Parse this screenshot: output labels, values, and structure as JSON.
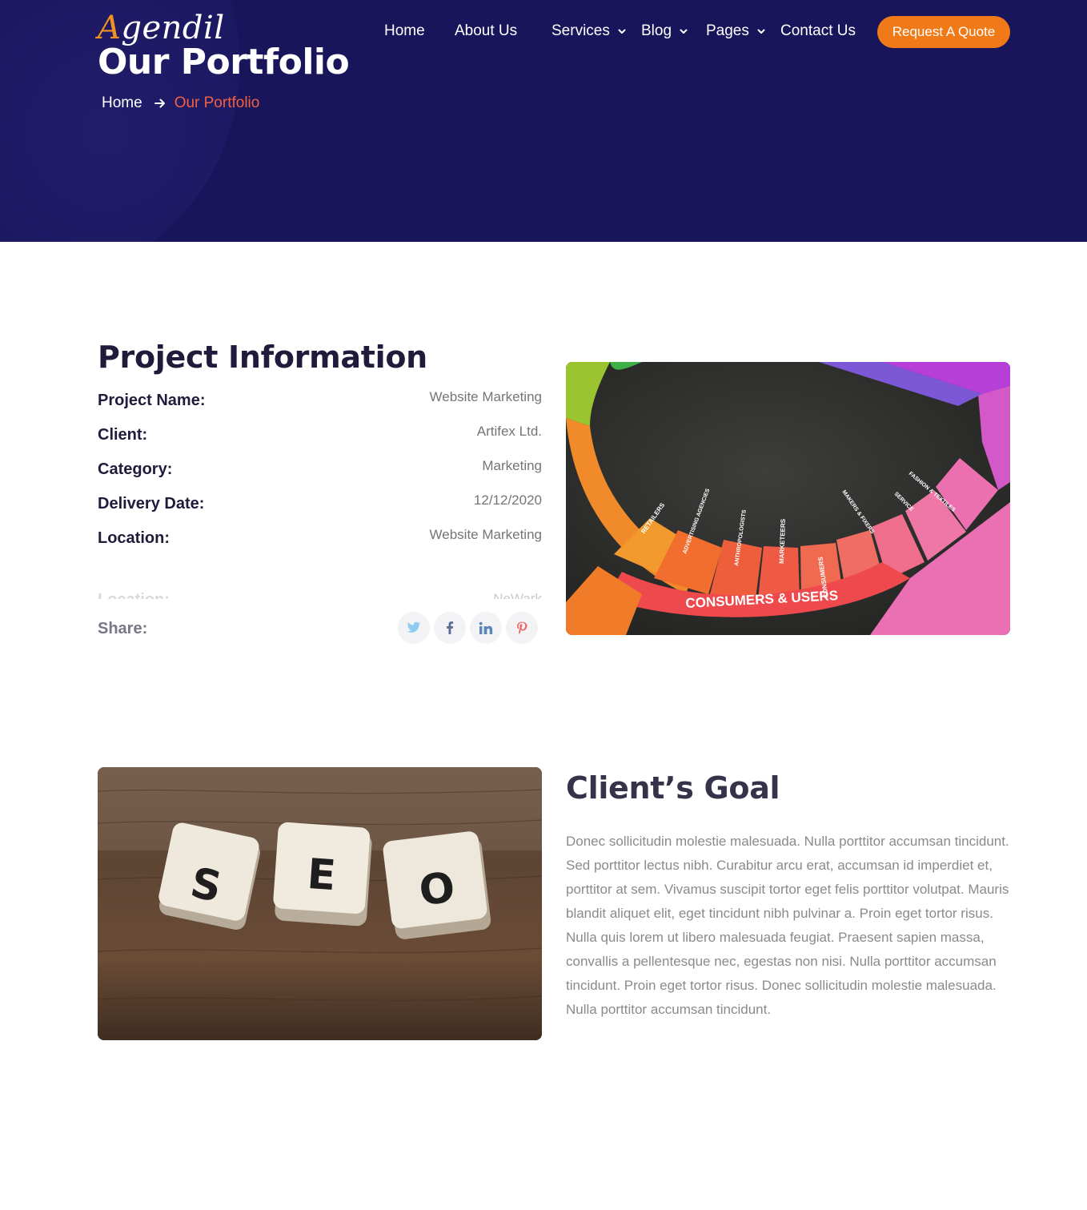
{
  "brand": {
    "logo_first": "A",
    "logo_rest": "gendil"
  },
  "hero": {
    "title": "Our Portfolio",
    "breadcrumb": {
      "home": "Home",
      "current": "Our Portfolio"
    }
  },
  "nav": {
    "items": [
      {
        "label": "Home",
        "dropdown": false
      },
      {
        "label": "About Us",
        "dropdown": false
      },
      {
        "label": "Services",
        "dropdown": true
      },
      {
        "label": "Blog",
        "dropdown": true
      },
      {
        "label": "Pages",
        "dropdown": true
      },
      {
        "label": "Contact Us",
        "dropdown": false
      }
    ],
    "cta": "Request A Quote"
  },
  "project": {
    "title": "Project Information",
    "rows": [
      {
        "label": "Project Name:",
        "value": "Website Marketing"
      },
      {
        "label": "Client:",
        "value": "Artifex Ltd."
      },
      {
        "label": "Category:",
        "value": "Marketing"
      },
      {
        "label": "Delivery Date:",
        "value": "12/12/2020"
      },
      {
        "label": "Location:",
        "value": "Website Marketing"
      }
    ],
    "faded_row": {
      "label": "Location:",
      "value": "NeWark"
    },
    "share_label": "Share:",
    "social": [
      "twitter-icon",
      "facebook-icon",
      "linkedin-icon",
      "pinterest-icon"
    ]
  },
  "images": {
    "wheel_caption": "CONSUMERS & USERS",
    "wheel_segments": [
      "RETAILERS",
      "ADVERTISING AGENCIES",
      "ANTHROPOLOGISTS",
      "MARKETEERS",
      "CONSUMERS",
      "MAKERS & FIXERS",
      "SERVICE",
      "FASHION & TEXTILES"
    ],
    "seo_tiles": [
      "S",
      "E",
      "O"
    ]
  },
  "goal": {
    "title": "Client’s Goal",
    "text": "Donec sollicitudin molestie malesuada. Nulla porttitor accumsan tincidunt. Sed porttitor lectus nibh. Curabitur arcu erat, accumsan id imperdiet et, porttitor at sem. Vivamus suscipit tortor eget felis porttitor volutpat. Mauris blandit aliquet elit, eget tincidunt nibh pulvinar a. Proin eget tortor risus. Nulla quis lorem ut libero malesuada feugiat. Praesent sapien massa, convallis a pellentesque nec, egestas non nisi. Nulla porttitor accumsan tincidunt. Proin eget tortor risus. Donec sollicitudin molestie malesuada. Nulla porttitor accumsan tincidunt."
  },
  "colors": {
    "hero_bg": "#19155a",
    "accent_orange": "#f17a18",
    "breadcrumb_active": "#f26140",
    "heading": "#1f1c3b"
  }
}
